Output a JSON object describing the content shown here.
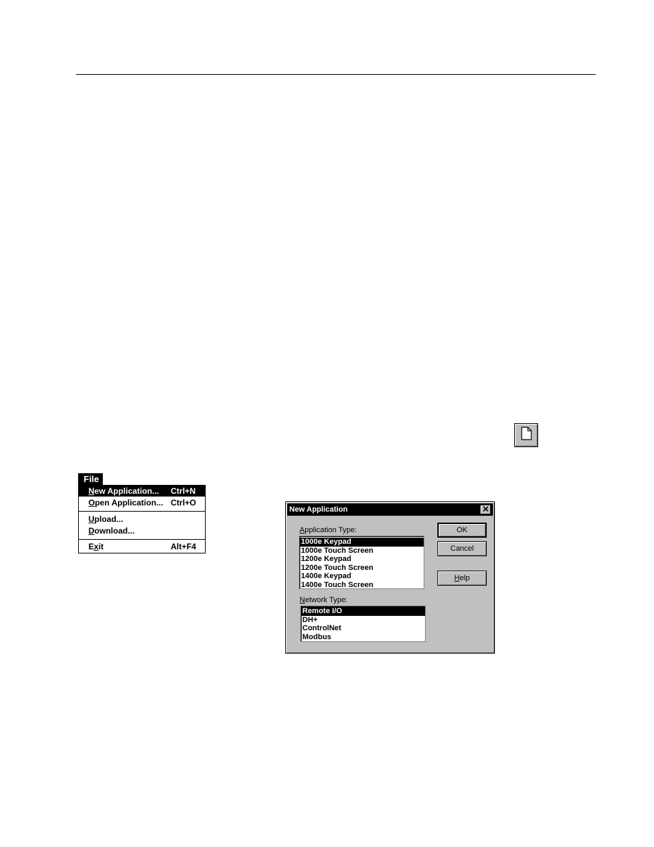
{
  "toolbar": {
    "new_icon": "new-document-icon"
  },
  "file_menu": {
    "title": "File",
    "items": [
      {
        "label_u": "N",
        "label_rest": "ew Application...",
        "shortcut": "Ctrl+N",
        "selected": true
      },
      {
        "label_u": "O",
        "label_rest": "pen Application...",
        "shortcut": "Ctrl+O",
        "selected": false
      },
      {
        "label_u": "U",
        "label_rest": "pload...",
        "shortcut": "",
        "selected": false
      },
      {
        "label_u": "D",
        "label_rest": "ownload...",
        "shortcut": "",
        "selected": false
      },
      {
        "label_pre": "E",
        "label_u": "x",
        "label_rest": "it",
        "shortcut": "Alt+F4",
        "selected": false
      }
    ]
  },
  "dialog": {
    "title": "New Application",
    "close_icon": "close-icon",
    "app_type": {
      "label_u": "A",
      "label_rest": "pplication Type:",
      "options": [
        "1000e Keypad",
        "1000e Touch Screen",
        "1200e Keypad",
        "1200e Touch Screen",
        "1400e Keypad",
        "1400e Touch Screen"
      ],
      "selected": 0
    },
    "network_type": {
      "label_u": "N",
      "label_rest": "etwork Type:",
      "options": [
        "Remote I/O",
        "DH+",
        "ControlNet",
        "Modbus"
      ],
      "selected": 0
    },
    "buttons": {
      "ok": "OK",
      "cancel": "Cancel",
      "help_u": "H",
      "help_rest": "elp"
    }
  }
}
